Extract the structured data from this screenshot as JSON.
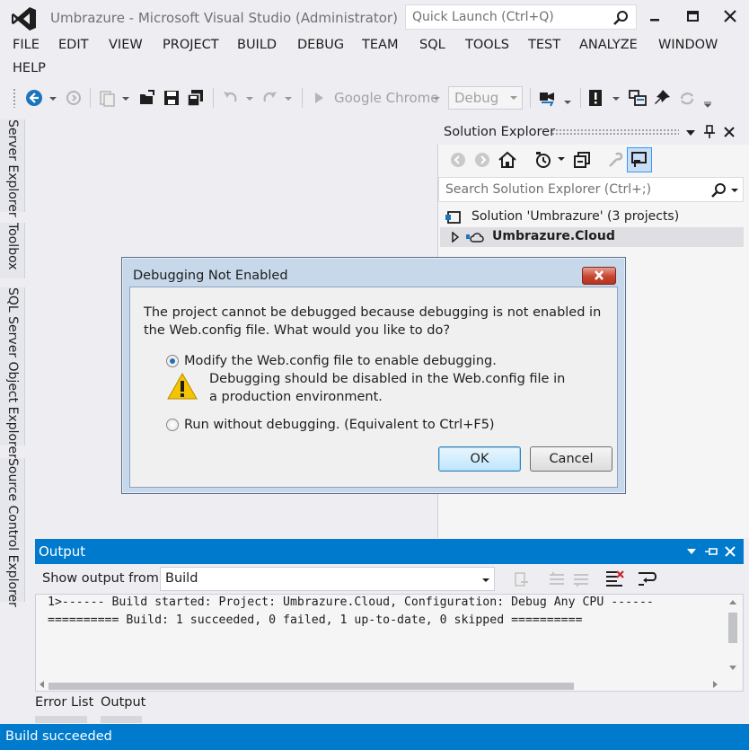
{
  "window": {
    "title": "Umbrazure - Microsoft Visual Studio (Administrator)",
    "quick_launch_placeholder": "Quick Launch (Ctrl+Q)"
  },
  "menu": [
    "FILE",
    "EDIT",
    "VIEW",
    "PROJECT",
    "BUILD",
    "DEBUG",
    "TEAM",
    "SQL",
    "TOOLS",
    "TEST",
    "ANALYZE",
    "WINDOW",
    "HELP"
  ],
  "toolbar": {
    "browser_label": "Google Chrome",
    "config_value": "Debug"
  },
  "side_tabs": [
    "Server Explorer",
    "Toolbox",
    "SQL Server Object Explorer",
    "Source Control Explorer"
  ],
  "solution_explorer": {
    "title": "Solution Explorer",
    "search_placeholder": "Search Solution Explorer (Ctrl+;)",
    "solution_label": "Solution 'Umbrazure' (3 projects)",
    "project_label": "Umbrazure.Cloud"
  },
  "dialog": {
    "title": "Debugging Not Enabled",
    "message": "The project cannot be debugged because debugging is not enabled in the Web.config file. What would you like to do?",
    "option1_label": "Modify the Web.config file to enable debugging.",
    "option1_warning": "Debugging should be disabled in the Web.config file in a production environment.",
    "option2_label": "Run without debugging. (Equivalent to Ctrl+F5)",
    "ok_label": "OK",
    "cancel_label": "Cancel"
  },
  "output": {
    "title": "Output",
    "show_from_label": "Show output from:",
    "show_from_value": "Build",
    "lines": [
      "1>------ Build started: Project: Umbrazure.Cloud, Configuration: Debug Any CPU ------",
      "========== Build: 1 succeeded, 0 failed, 1 up-to-date, 0 skipped =========="
    ]
  },
  "bottom_tabs": [
    "Error List",
    "Output"
  ],
  "status": "Build succeeded",
  "colors": {
    "accent": "#007acc",
    "logo": "#68217a",
    "warning": "#f5c400"
  }
}
